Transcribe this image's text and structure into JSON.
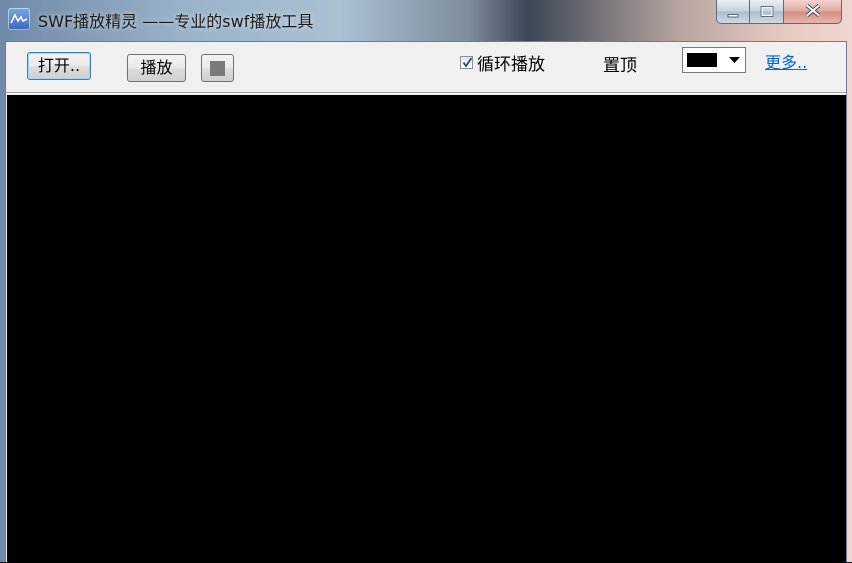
{
  "window": {
    "title": "SWF播放精灵 ——专业的swf播放工具"
  },
  "toolbar": {
    "open_label": "打开..",
    "play_label": "播放",
    "loop_label": "循环播放",
    "loop_checked": true,
    "topmost_label": "置顶",
    "bg_color": "#000000",
    "more_label": "更多.."
  },
  "icons": {
    "app": "app-icon",
    "minimize": "minimize-icon",
    "maximize": "maximize-icon",
    "close": "close-icon",
    "stop": "stop-icon",
    "dropdown": "chevron-down-icon",
    "check": "checkmark-icon"
  }
}
